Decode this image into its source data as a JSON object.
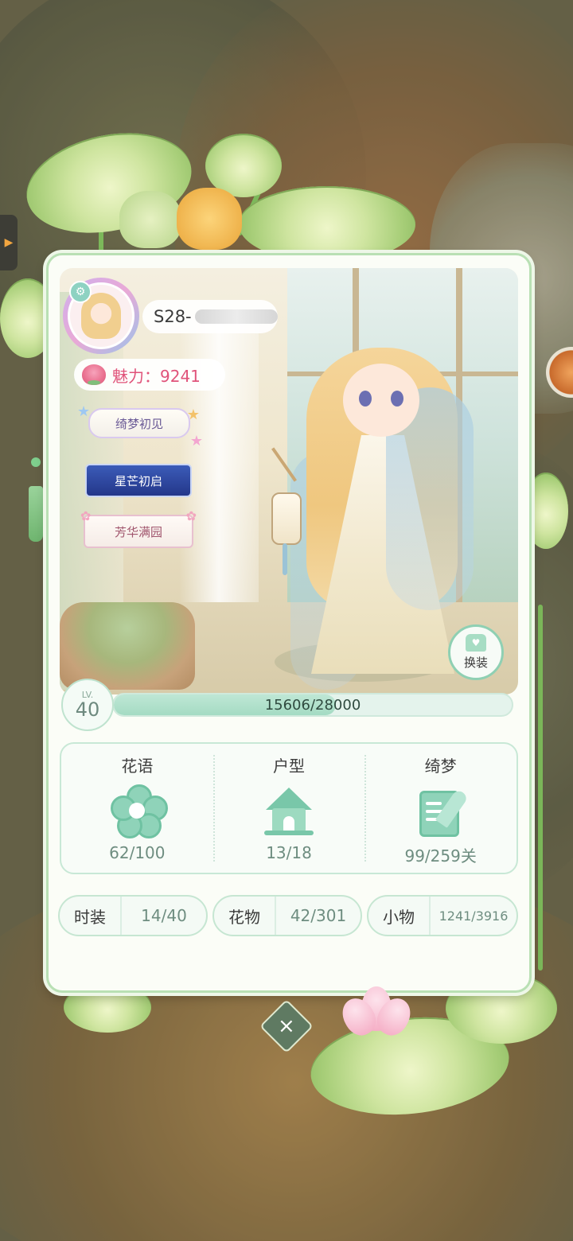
{
  "player": {
    "name_prefix": "S28-",
    "charm_text": "魅力：9241",
    "badges": [
      "绮梦初见",
      "星芒初启",
      "芳华满园"
    ],
    "outfit_button": "换装"
  },
  "level": {
    "label": "LV.",
    "value": "40",
    "xp_text": "15606/28000",
    "xp_fraction": 0.557
  },
  "stats": [
    {
      "title": "花语",
      "value": "62/100",
      "icon": "flower-icon"
    },
    {
      "title": "户型",
      "value": "13/18",
      "icon": "house-icon"
    },
    {
      "title": "绮梦",
      "value": "99/259关",
      "icon": "book-quill-icon"
    }
  ],
  "collections": [
    {
      "label": "时装",
      "value": "14/40"
    },
    {
      "label": "花物",
      "value": "42/301"
    },
    {
      "label": "小物",
      "value": "1241/3916"
    }
  ],
  "colors": {
    "accent_green": "#8fd3b9",
    "charm_pink": "#e0537a",
    "card_border": "#b9e0b4"
  }
}
